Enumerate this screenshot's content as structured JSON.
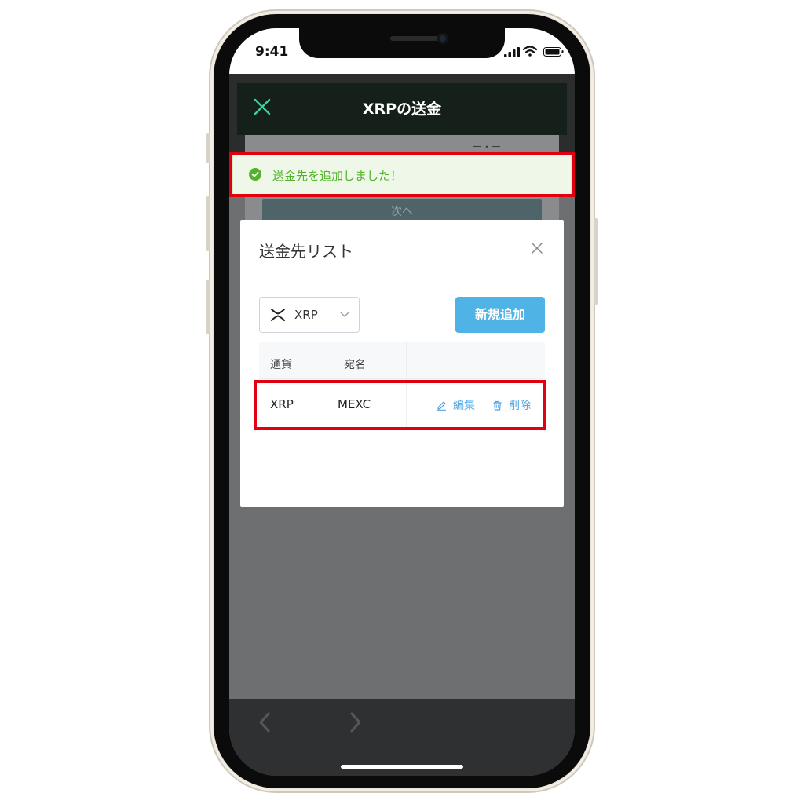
{
  "status_bar": {
    "time": "9:41"
  },
  "app_bar": {
    "title": "XRPの送金"
  },
  "background": {
    "partial_text": "ー・ー",
    "next_label": "次へ"
  },
  "toast": {
    "message": "送金先を追加しました！"
  },
  "modal": {
    "title": "送金先リスト",
    "currency_select": {
      "value": "XRP"
    },
    "add_button_label": "新規追加",
    "table": {
      "columns": [
        "通貨",
        "宛名"
      ],
      "rows": [
        {
          "currency": "XRP",
          "name": "MEXC",
          "edit_label": "編集",
          "delete_label": "削除"
        }
      ]
    }
  },
  "colors": {
    "accent_green": "#3ad29f",
    "toast_green": "#52b32b",
    "link_blue": "#4fa4e0",
    "add_button": "#4fb3e5",
    "highlight_red": "#e10010"
  }
}
